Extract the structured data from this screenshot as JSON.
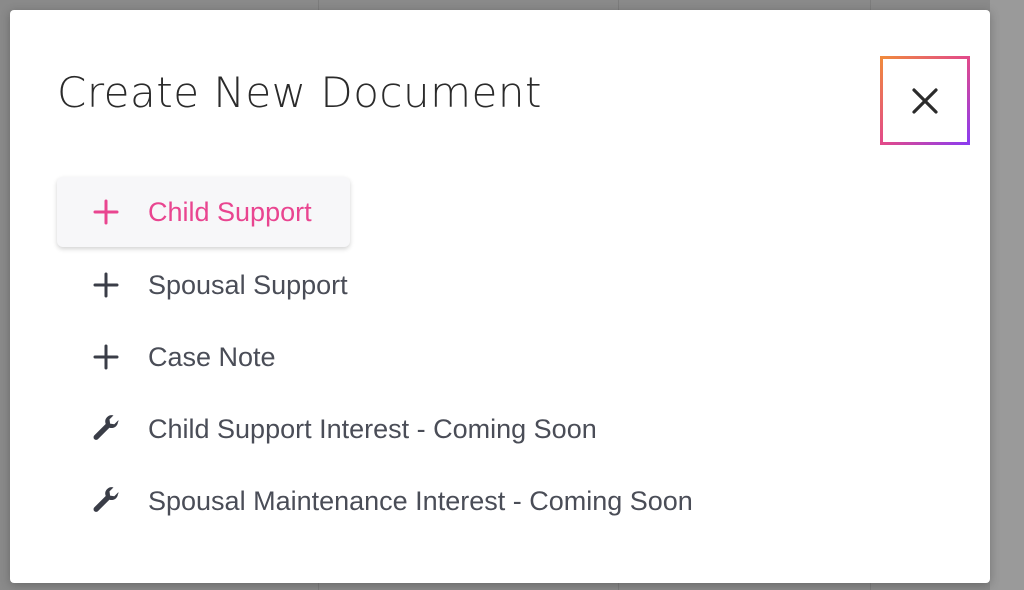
{
  "modal": {
    "title": "Create New Document",
    "close_icon": "close-icon"
  },
  "menu": {
    "items": [
      {
        "label": "Child Support",
        "icon": "plus-icon",
        "active": true
      },
      {
        "label": "Spousal Support",
        "icon": "plus-icon",
        "active": false
      },
      {
        "label": "Case Note",
        "icon": "plus-icon",
        "active": false
      },
      {
        "label": "Child Support Interest - Coming Soon",
        "icon": "wrench-icon",
        "active": false
      },
      {
        "label": "Spousal Maintenance Interest - Coming Soon",
        "icon": "wrench-icon",
        "active": false
      }
    ]
  },
  "colors": {
    "accent": "#e94590",
    "text": "#4a4d57",
    "title": "#2b2b2b",
    "close_gradient": [
      "#f08a3c",
      "#e24a8a",
      "#8b3cf0"
    ]
  }
}
